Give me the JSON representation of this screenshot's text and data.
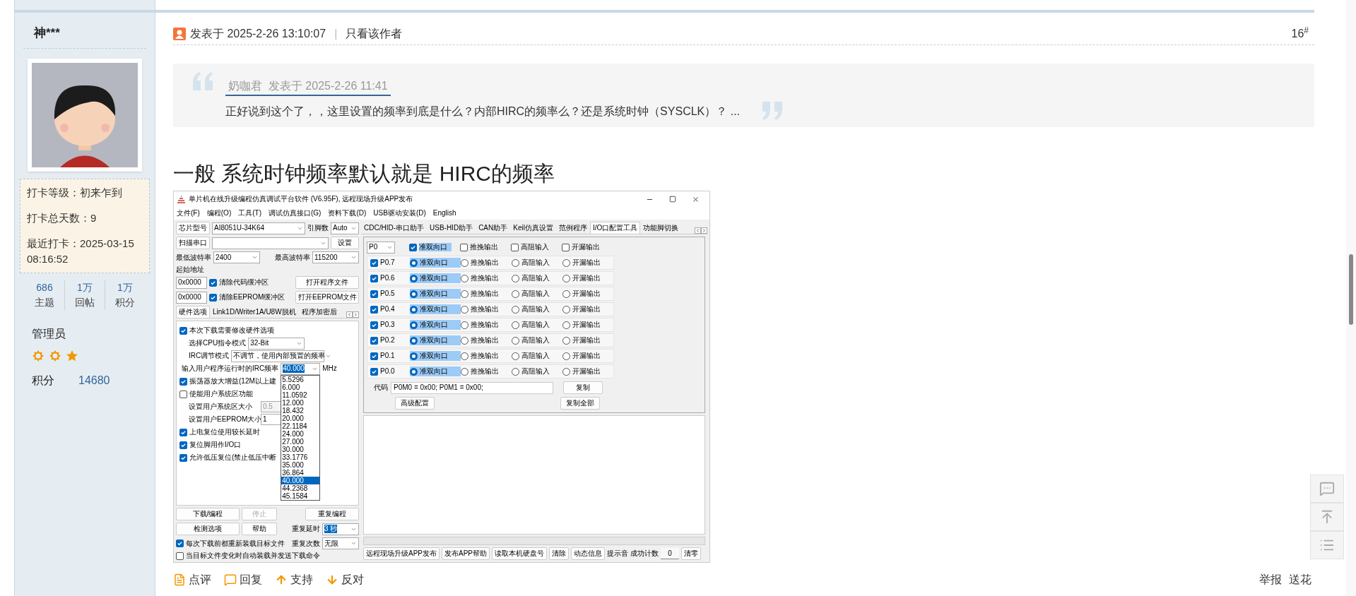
{
  "sidebar": {
    "username": "神***",
    "avatar": {
      "kind": "picture"
    },
    "checkin": [
      "打卡等级：初来乍到",
      "打卡总天数：9",
      "最近打卡：2025-03-15 08:16:52"
    ],
    "stats": [
      {
        "value": "686",
        "label": "主题"
      },
      {
        "value": "1万",
        "label": "回帖"
      },
      {
        "value": "1万",
        "label": "积分"
      }
    ],
    "group": "管理员",
    "rank_icons": [
      {
        "kind": "sun"
      },
      {
        "kind": "sun"
      },
      {
        "kind": "star"
      }
    ],
    "points": {
      "label": "积分",
      "value": "14680"
    }
  },
  "post": {
    "posted": "发表于 2025-2-26 13:10:07",
    "separator": "|",
    "author_only": "只看该作者",
    "floor": "16$^{#}$",
    "quote": {
      "byline": "奶咖君  发表于 2025-2-26 11:41",
      "text": "正好说到这个了，，这里设置的频率到底是什么？内部HIRC的频率么？还是系统时钟（SYSCLK）？ ..."
    },
    "heading": "一般 系统时钟频率默认就是 HIRC的频率",
    "app": {
      "title": "单片机在线升级编程仿真调试平台软件 (V6.95F), 远程现场升级APP发布",
      "menu": [
        "文件(F)",
        "编程(O)",
        "工具(T)",
        "调试仿真接口(G)",
        "资料下载(D)",
        "USB驱动安装(D)",
        "English"
      ],
      "chip": {
        "button": "芯片型号",
        "value": "AI8051U-34K64",
        "pins_label": "引脚数",
        "pins": "Auto"
      },
      "port": {
        "button": "扫描串口",
        "settings": "设置"
      },
      "baud": {
        "min_label": "最低波特率",
        "min": "2400",
        "max_label": "最高波特率",
        "max": "115200"
      },
      "start_address_label": "起始地址",
      "buffers": [
        {
          "address": "0x0000",
          "label": "清除代码缓冲区",
          "checked": true,
          "button": "打开程序文件"
        },
        {
          "address": "0x0000",
          "label": "清除EEPROM缓冲区",
          "checked": true,
          "button": "打开EEPROM文件"
        }
      ],
      "left_tabs": [
        {
          "label": "硬件选项",
          "selected": true
        },
        {
          "label": "Link1D/Writer1A/U8W脱机",
          "selected": false
        },
        {
          "label": "程序加密后",
          "selected": false
        }
      ],
      "options": [
        {
          "kind": "check",
          "label": "本次下载需要修改硬件选项",
          "checked": true
        },
        {
          "kind": "select",
          "label": "选择CPU指令模式",
          "value": "32-Bit"
        },
        {
          "kind": "select",
          "label": "IRC调节模式",
          "value": "不调节，使用内部预置的频率"
        },
        {
          "kind": "frequency",
          "label": "输入用户程序运行时的IRC频率",
          "value": "40.000",
          "unit": "MHz"
        },
        {
          "kind": "check",
          "label": "振荡器放大增益(12M以上建",
          "checked": true
        },
        {
          "kind": "check",
          "label": "使能用户系统区功能",
          "checked": false
        },
        {
          "kind": "input",
          "label": "设置用户系统区大小",
          "value": "0.5",
          "disabled": true
        },
        {
          "kind": "input",
          "label": "设置用户EEPROM大小",
          "value": "1",
          "disabled": false
        },
        {
          "kind": "check",
          "label": "上电复位使用较长延时",
          "checked": true
        },
        {
          "kind": "check",
          "label": "复位脚用作I/O口",
          "checked": true
        },
        {
          "kind": "check",
          "label": "允许低压复位(禁止低压中断",
          "checked": true
        }
      ],
      "frequency_list": [
        {
          "value": "5.5296",
          "selected": false
        },
        {
          "value": "6.000",
          "selected": false
        },
        {
          "value": "11.0592",
          "selected": false
        },
        {
          "value": "12.000",
          "selected": false
        },
        {
          "value": "18.432",
          "selected": false
        },
        {
          "value": "20.000",
          "selected": false
        },
        {
          "value": "22.1184",
          "selected": false
        },
        {
          "value": "24.000",
          "selected": false
        },
        {
          "value": "27.000",
          "selected": false
        },
        {
          "value": "30.000",
          "selected": false
        },
        {
          "value": "33.1776",
          "selected": false
        },
        {
          "value": "35.000",
          "selected": false
        },
        {
          "value": "36.864",
          "selected": false
        },
        {
          "value": "40.000",
          "selected": true
        },
        {
          "value": "44.2368",
          "selected": false
        },
        {
          "value": "45.1584",
          "selected": false
        }
      ],
      "actions": [
        {
          "label": "下载/编程",
          "disabled": false
        },
        {
          "label": "停止",
          "disabled": true
        },
        {
          "label": "重复编程",
          "disabled": false
        }
      ],
      "check_options": "检测选项",
      "help": "帮助",
      "repeat_delay": {
        "label": "重复延时",
        "value": "3 秒"
      },
      "repeat_count": {
        "label": "重复次数",
        "value": "无限"
      },
      "auto_options": [
        {
          "label": "每次下载前都重新装载目标文件",
          "checked": true
        },
        {
          "label": "当目标文件变化时自动装载并发送下载命令",
          "checked": false
        }
      ],
      "right_tabs": [
        {
          "label": "CDC/HID-串口助手",
          "selected": false
        },
        {
          "label": "USB-HID助手",
          "selected": false
        },
        {
          "label": "CAN助手",
          "selected": false
        },
        {
          "label": "Keil仿真设置",
          "selected": false
        },
        {
          "label": "范例程序",
          "selected": false
        },
        {
          "label": "I/O口配置工具",
          "selected": true
        },
        {
          "label": "功能脚切换",
          "selected": false
        }
      ],
      "io": {
        "port": "P0",
        "header": [
          {
            "label": "准双向口",
            "checked": true
          },
          {
            "label": "推挽输出",
            "checked": false
          },
          {
            "label": "高阻输入",
            "checked": false
          },
          {
            "label": "开漏输出",
            "checked": false
          }
        ],
        "pins": [
          {
            "pin": "P0.7",
            "enabled": true,
            "modes": [
              {
                "label": "准双向口",
                "selected": true
              },
              {
                "label": "推挽输出",
                "selected": false
              },
              {
                "label": "高阻输入",
                "selected": false
              },
              {
                "label": "开漏输出",
                "selected": false
              }
            ]
          },
          {
            "pin": "P0.6",
            "enabled": true,
            "modes": [
              {
                "label": "准双向口",
                "selected": true
              },
              {
                "label": "推挽输出",
                "selected": false
              },
              {
                "label": "高阻输入",
                "selected": false
              },
              {
                "label": "开漏输出",
                "selected": false
              }
            ]
          },
          {
            "pin": "P0.5",
            "enabled": true,
            "modes": [
              {
                "label": "准双向口",
                "selected": true
              },
              {
                "label": "推挽输出",
                "selected": false
              },
              {
                "label": "高阻输入",
                "selected": false
              },
              {
                "label": "开漏输出",
                "selected": false
              }
            ]
          },
          {
            "pin": "P0.4",
            "enabled": true,
            "modes": [
              {
                "label": "准双向口",
                "selected": true
              },
              {
                "label": "推挽输出",
                "selected": false
              },
              {
                "label": "高阻输入",
                "selected": false
              },
              {
                "label": "开漏输出",
                "selected": false
              }
            ]
          },
          {
            "pin": "P0.3",
            "enabled": true,
            "modes": [
              {
                "label": "准双向口",
                "selected": true
              },
              {
                "label": "推挽输出",
                "selected": false
              },
              {
                "label": "高阻输入",
                "selected": false
              },
              {
                "label": "开漏输出",
                "selected": false
              }
            ]
          },
          {
            "pin": "P0.2",
            "enabled": true,
            "modes": [
              {
                "label": "准双向口",
                "selected": true
              },
              {
                "label": "推挽输出",
                "selected": false
              },
              {
                "label": "高阻输入",
                "selected": false
              },
              {
                "label": "开漏输出",
                "selected": false
              }
            ]
          },
          {
            "pin": "P0.1",
            "enabled": true,
            "modes": [
              {
                "label": "准双向口",
                "selected": true
              },
              {
                "label": "推挽输出",
                "selected": false
              },
              {
                "label": "高阻输入",
                "selected": false
              },
              {
                "label": "开漏输出",
                "selected": false
              }
            ]
          },
          {
            "pin": "P0.0",
            "enabled": true,
            "modes": [
              {
                "label": "准双向口",
                "selected": true
              },
              {
                "label": "推挽输出",
                "selected": false
              },
              {
                "label": "高阻输入",
                "selected": false
              },
              {
                "label": "开漏输出",
                "selected": false
              }
            ]
          }
        ],
        "code_label": "代码",
        "code": "P0M0 = 0x00; P0M1 = 0x00;",
        "copy": "复制",
        "advanced": "高级配置",
        "copy_all": "复制全部"
      },
      "progress": {
        "level": 0
      },
      "bottom": [
        {
          "kind": "button",
          "label": "远程现场升级APP发布"
        },
        {
          "kind": "button",
          "label": "发布APP帮助"
        },
        {
          "kind": "button",
          "label": "读取本机硬盘号"
        },
        {
          "kind": "button",
          "label": "清除"
        },
        {
          "kind": "button",
          "label": "动态信息"
        },
        {
          "kind": "label",
          "label": "提示音"
        },
        {
          "kind": "label",
          "label": "成功计数"
        },
        {
          "kind": "field",
          "label": "0"
        },
        {
          "kind": "button",
          "label": "清零"
        }
      ]
    },
    "actions": [
      {
        "label": "点评",
        "kind": "comment"
      },
      {
        "label": "回复",
        "kind": "reply"
      },
      {
        "label": "支持",
        "kind": "up"
      },
      {
        "label": "反对",
        "kind": "down"
      }
    ],
    "links": [
      "举报",
      "送花"
    ]
  }
}
